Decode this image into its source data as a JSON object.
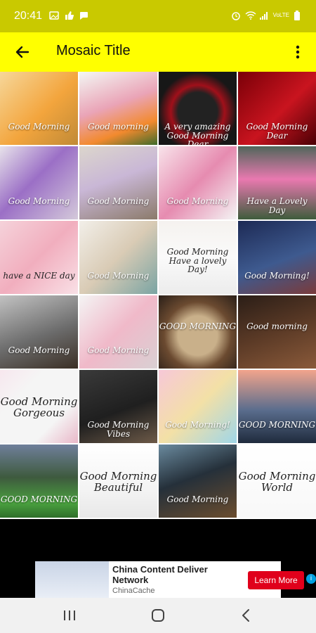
{
  "status_bar": {
    "time": "20:41",
    "left_icons": [
      "image-icon",
      "thumb-icon",
      "chat-icon"
    ],
    "right_icons": [
      "alarm-icon",
      "wifi-icon",
      "signal-icon",
      "volte-icon",
      "battery-icon"
    ],
    "volte": "VoLTE"
  },
  "app_bar": {
    "title": "Mosaic Title",
    "back_icon": "arrow-left-icon",
    "more_icon": "more-vertical-icon"
  },
  "grid": {
    "tiles": [
      {
        "caption": "Good Morning",
        "bg": "linear-gradient(135deg,#f6d79a,#f3a53d 55%,#c08a37)"
      },
      {
        "caption": "Good morning",
        "bg": "linear-gradient(160deg,#f3f7f4,#eaa4b7 45%,#f28a2e 75%,#3d6b2b)"
      },
      {
        "caption": "A very amazing Good Morning Dear",
        "bg": "radial-gradient(circle at 50% 55%,#222 35%,#a0101a 48%,#171717 70%)"
      },
      {
        "caption": "Good Morning Dear",
        "bg": "linear-gradient(135deg,#7a0008,#c9141f 55%,#4a0005)"
      },
      {
        "caption": "Good Morning",
        "bg": "linear-gradient(135deg,#e7e2ea,#9b6fc6 45%,#d4c9da)"
      },
      {
        "caption": "Good Morning",
        "bg": "linear-gradient(160deg,#dcd6cc,#c9b7d6 45%,#8b7a6a)"
      },
      {
        "caption": "Good Morning",
        "bg": "linear-gradient(135deg,#f8e3ea,#e68bb0 50%,#f4f4f4)"
      },
      {
        "caption": "Have a Lovely Day",
        "bg": "linear-gradient(180deg,#50665a,#e979b0 45%,#3e5c3c)"
      },
      {
        "caption": "have a NICE day",
        "bg": "linear-gradient(135deg,#f5d2da,#f1aebe 50%,#f9e0e6)"
      },
      {
        "caption": "Good Morning",
        "bg": "linear-gradient(135deg,#f2efe9,#d9cbb5 50%,#7aa4a3)"
      },
      {
        "caption": "Good Morning Have a lovely Day!",
        "bg": "linear-gradient(180deg,#f5f2ef,#fafafa 50%,#ececec)"
      },
      {
        "caption": "Good Morning!",
        "bg": "linear-gradient(160deg,#1d2a55,#3e5a8f 55%,#7a3b3b)"
      },
      {
        "caption": "Good Morning",
        "bg": "linear-gradient(160deg,#c2c2c2,#6c6c6c 55%,#3b2f25)"
      },
      {
        "caption": "Good Morning",
        "bg": "linear-gradient(135deg,#f4f4f4,#f0b9c9 50%,#d9d0d3)"
      },
      {
        "caption": "GOOD MORNING",
        "bg": "radial-gradient(circle at 50% 55%,#c9b08a 35%,#6b4a30 60%,#2a1f18)"
      },
      {
        "caption": "Good morning",
        "bg": "linear-gradient(160deg,#2b1e17,#5b3a26 50%,#8a5a3a)"
      },
      {
        "caption": "Good Morning Gorgeous",
        "bg": "linear-gradient(135deg,#f7e7ee,#f5f5f5 30%,#f5f5f5 70%,#e9b7c8)"
      },
      {
        "caption": "Good Morning Vibes",
        "bg": "linear-gradient(160deg,#3a3a3a,#1f1f1f 55%,#6d5a48)"
      },
      {
        "caption": "Good Morning!",
        "bg": "linear-gradient(135deg,#f7c8d8,#f3e0a6 50%,#9fd6e8)"
      },
      {
        "caption": "GOOD MORNING",
        "bg": "linear-gradient(180deg,#f2a48c,#5a6d8d 55%,#1f2b3d)"
      },
      {
        "caption": "GOOD MORNING",
        "bg": "linear-gradient(180deg,#6f7f9b,#3e5a3e 45%,#4aa13f 80%,#2f6e2a)"
      },
      {
        "caption": "Good Morning Beautiful",
        "bg": "linear-gradient(180deg,#ffffff,#f4f4f4 60%,#e8e8e8)"
      },
      {
        "caption": "Good Morning",
        "bg": "linear-gradient(160deg,#6a8a9e,#25303a 45%,#6b4d2e)"
      },
      {
        "caption": "Good Morning World",
        "bg": "linear-gradient(180deg,#ffffff,#f8f8f8)"
      }
    ]
  },
  "ad": {
    "title": "China Content Deliver Network",
    "sub": "ChinaCache",
    "button": "Learn More",
    "info": "i"
  },
  "nav_bar": {
    "recent_icon": "recent-apps-icon",
    "home_icon": "home-icon",
    "back_icon": "back-nav-icon"
  }
}
